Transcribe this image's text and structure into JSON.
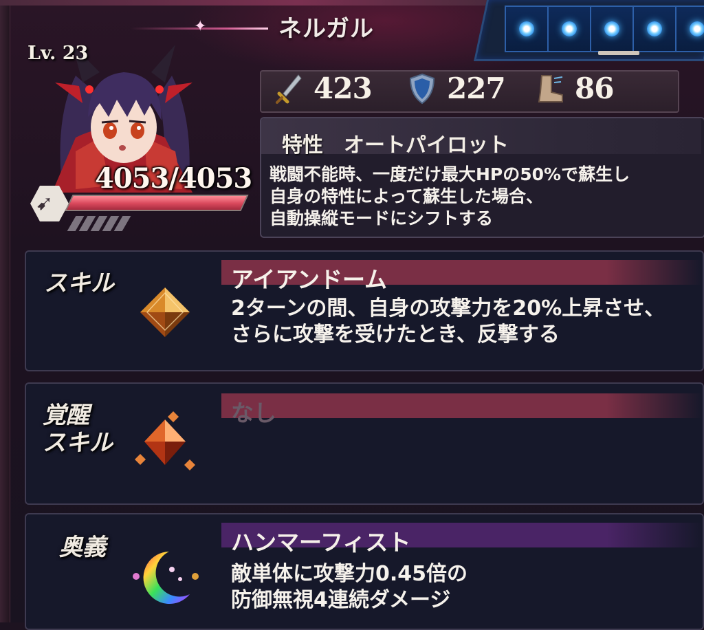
{
  "character": {
    "name": "ネルガル",
    "level": "Lv. 23",
    "hp_text": "4053/4053",
    "hp_fraction": 1.0
  },
  "slots": {
    "count": 5,
    "selected_index": 2
  },
  "stats": {
    "attack": "423",
    "defense": "227",
    "speed": "86"
  },
  "trait": {
    "label": "特性",
    "name": "オートパイロット",
    "description": "戦闘不能時、一度だけ最大HPの50%で蘇生し\n自身の特性によって蘇生した場合、\n自動操縦モードにシフトする"
  },
  "skill": {
    "label": "スキル",
    "name": "アイアンドーム",
    "description": "2ターンの間、自身の攻撃力を20%上昇させ、\nさらに攻撃を受けたとき、反撃する"
  },
  "awakened_skill": {
    "label": "覚醒\nスキル",
    "name": "なし"
  },
  "ultimate": {
    "label": "奥義",
    "name": "ハンマーフィスト",
    "description": "敵単体に攻撃力0.45倍の\n防御無視4連続ダメージ"
  },
  "colors": {
    "skill_band": "#7a2f45",
    "awakened_band": "#7a2f45",
    "ultimate_band": "#4a2466",
    "hp_fill": "#d9485c",
    "slot_orb": "#49b6ff"
  },
  "icons": {
    "attack": "sword-icon",
    "defense": "shield-icon",
    "speed": "boot-icon",
    "hp": "arrow-hex-icon",
    "skill": "amber-gem-icon",
    "awakened": "cluster-gem-icon",
    "ultimate": "rainbow-crescent-icon"
  }
}
